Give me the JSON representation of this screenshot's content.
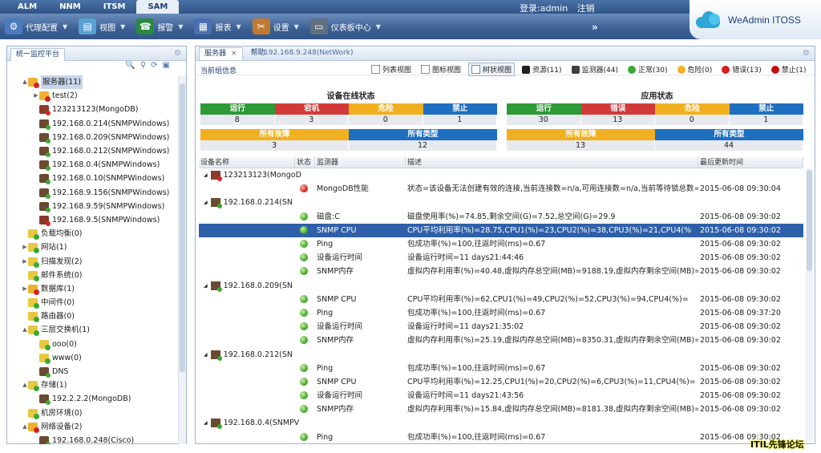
{
  "top_tabs": [
    "ALM",
    "NNM",
    "ITSM",
    "SAM"
  ],
  "login": {
    "label": "登录:admin",
    "logout": "注销"
  },
  "toolbar": [
    {
      "label": "代理配置",
      "icon": "agent-icon",
      "color": "#4a7ac0"
    },
    {
      "label": "视图",
      "icon": "view-icon",
      "color": "#5aa0d0"
    },
    {
      "label": "报警",
      "icon": "alarm-icon",
      "color": "#2a8a40"
    },
    {
      "label": "报表",
      "icon": "report-icon",
      "color": "#4a70b0"
    },
    {
      "label": "设置",
      "icon": "settings-icon",
      "color": "#c07a30"
    },
    {
      "label": "仪表板中心",
      "icon": "dashboard-icon",
      "color": "#607080"
    }
  ],
  "toolbar_more": "»",
  "brand": "WeAdmin ITOSS",
  "left_panel": {
    "title": "统一监控平台",
    "tree": [
      {
        "label": "服务器(11)",
        "icon": "folder-red",
        "depth": 0,
        "exp": "▲",
        "selected": true
      },
      {
        "label": "test(2)",
        "icon": "folder-red",
        "depth": 1,
        "exp": "▶"
      },
      {
        "label": "123213123(MongoDB)",
        "icon": "server-red",
        "depth": 1,
        "exp": ""
      },
      {
        "label": "192.168.0.214(SNMPWindows)",
        "icon": "server-ok",
        "depth": 1,
        "exp": ""
      },
      {
        "label": "192.168.0.209(SNMPWindows)",
        "icon": "server-ok",
        "depth": 1,
        "exp": ""
      },
      {
        "label": "192.168.0.212(SNMPWindows)",
        "icon": "server-ok",
        "depth": 1,
        "exp": ""
      },
      {
        "label": "192.168.0.4(SNMPWindows)",
        "icon": "server-ok",
        "depth": 1,
        "exp": ""
      },
      {
        "label": "192.168.0.10(SNMPWindows)",
        "icon": "server-ok",
        "depth": 1,
        "exp": ""
      },
      {
        "label": "192.168.9.156(SNMPWindows)",
        "icon": "server-ok",
        "depth": 1,
        "exp": ""
      },
      {
        "label": "192.168.9.59(SNMPWindows)",
        "icon": "server-ok",
        "depth": 1,
        "exp": ""
      },
      {
        "label": "192.168.9.5(SNMPWindows)",
        "icon": "server-red",
        "depth": 1,
        "exp": ""
      },
      {
        "label": "负载均衡(0)",
        "icon": "folder-ok",
        "depth": 0,
        "exp": ""
      },
      {
        "label": "网站(1)",
        "icon": "folder-ok",
        "depth": 0,
        "exp": "▶"
      },
      {
        "label": "扫描发现(2)",
        "icon": "folder-ok",
        "depth": 0,
        "exp": "▶"
      },
      {
        "label": "邮件系统(0)",
        "icon": "folder-ok",
        "depth": 0,
        "exp": ""
      },
      {
        "label": "数据库(1)",
        "icon": "folder-red",
        "depth": 0,
        "exp": "▶"
      },
      {
        "label": "中间件(0)",
        "icon": "folder-ok",
        "depth": 0,
        "exp": ""
      },
      {
        "label": "路由器(0)",
        "icon": "folder-ok",
        "depth": 0,
        "exp": ""
      },
      {
        "label": "三层交换机(1)",
        "icon": "folder-ok",
        "depth": 0,
        "exp": "▲"
      },
      {
        "label": "ooo(0)",
        "icon": "folder-ok",
        "depth": 1,
        "exp": ""
      },
      {
        "label": "www(0)",
        "icon": "folder-ok",
        "depth": 1,
        "exp": ""
      },
      {
        "label": "DNS",
        "icon": "server-ok",
        "depth": 1,
        "exp": ""
      },
      {
        "label": "存储(1)",
        "icon": "folder-ok",
        "depth": 0,
        "exp": "▲"
      },
      {
        "label": "192.2.2.2(MongoDB)",
        "icon": "server-ok",
        "depth": 1,
        "exp": ""
      },
      {
        "label": "机房环境(0)",
        "icon": "folder-ok",
        "depth": 0,
        "exp": ""
      },
      {
        "label": "网络设备(2)",
        "icon": "folder-red",
        "depth": 0,
        "exp": "▲"
      },
      {
        "label": "192.168.0.248(Cisco)",
        "icon": "server-ok",
        "depth": 1,
        "exp": ""
      }
    ]
  },
  "right_panel": {
    "tabs": [
      {
        "label": "服务器",
        "close": "×"
      },
      {
        "label": "帮助",
        "close": ""
      }
    ],
    "title": "192.168.9.248(NetWork)",
    "group_info": "当前组信息",
    "views": [
      "列表视图",
      "图标视图",
      "树状视图"
    ],
    "filters": [
      {
        "label": "资源(11)",
        "color": "#202020"
      },
      {
        "label": "监测器(44)",
        "color": "#404040"
      },
      {
        "label": "正常(30)",
        "color": "#3aa830"
      },
      {
        "label": "危险(0)",
        "color": "#f0b020"
      },
      {
        "label": "错误(13)",
        "color": "#d42020"
      },
      {
        "label": "禁止(1)",
        "color": "#c01010"
      }
    ],
    "device_status": {
      "title": "设备在线状态",
      "row1": [
        {
          "label": "运行",
          "value": "8",
          "color": "#2e9a36"
        },
        {
          "label": "宕机",
          "value": "3",
          "color": "#d23a3a"
        },
        {
          "label": "危险",
          "value": "0",
          "color": "#f0b020"
        },
        {
          "label": "禁止",
          "value": "1",
          "color": "#1f6fc0"
        }
      ],
      "row2": [
        {
          "label": "所有故障",
          "value": "3",
          "color": "#f0b020"
        },
        {
          "label": "所有类型",
          "value": "12",
          "color": "#1f6fc0"
        }
      ]
    },
    "app_status": {
      "title": "应用状态",
      "row1": [
        {
          "label": "运行",
          "value": "30",
          "color": "#2e9a36"
        },
        {
          "label": "错误",
          "value": "13",
          "color": "#d23a3a"
        },
        {
          "label": "危险",
          "value": "0",
          "color": "#f0b020"
        },
        {
          "label": "禁止",
          "value": "1",
          "color": "#1f6fc0"
        }
      ],
      "row2": [
        {
          "label": "所有故障",
          "value": "13",
          "color": "#f0b020"
        },
        {
          "label": "所有类型",
          "value": "44",
          "color": "#1f6fc0"
        }
      ]
    },
    "table": {
      "headers": [
        "设备名称",
        "状态",
        "监测器",
        "描述",
        "最后更新时间"
      ],
      "rows": [
        {
          "group": "123213123(MongoD",
          "icon": "server-red"
        },
        {
          "status": "r",
          "monitor": "MongoDB性能",
          "desc": "状态=该设备无法创建有效的连接,当前连接数=n/a,可用连接数=n/a,当前等待锁总数=",
          "time": "2015-06-08 09:30:04"
        },
        {
          "group": "192.168.0.214(SN",
          "icon": "server-ok"
        },
        {
          "status": "g",
          "monitor": "磁盘:C",
          "desc": "磁盘使用率(%)=74.85,剩余空间(G)=7.52,总空间(G)=29.9",
          "time": "2015-06-08 09:30:02"
        },
        {
          "status": "g",
          "monitor": "SNMP CPU",
          "desc": "CPU平均利用率(%)=28.75,CPU1(%)=23,CPU2(%)=38,CPU3(%)=21,CPU4(%",
          "time": "2015-06-08 09:30:02",
          "selected": true
        },
        {
          "status": "g",
          "monitor": "Ping",
          "desc": "包成功率(%)=100,往返时间(ms)=0.67",
          "time": "2015-06-08 09:30:02"
        },
        {
          "status": "g",
          "monitor": "设备运行时间",
          "desc": "设备运行时间=11 days21:44:46",
          "time": "2015-06-08 09:30:02"
        },
        {
          "status": "g",
          "monitor": "SNMP内存",
          "desc": "虚拟内存利用率(%)=40.48,虚拟内存总空间(MB)=9188.19,虚拟内存剩余空间(MB)=",
          "time": "2015-06-08 09:30:02"
        },
        {
          "group": "192.168.0.209(SN",
          "icon": "server-ok"
        },
        {
          "status": "g",
          "monitor": "SNMP CPU",
          "desc": "CPU平均利用率(%)=62,CPU1(%)=49,CPU2(%)=52,CPU3(%)=94,CPU4(%)=",
          "time": "2015-06-08 09:30:02"
        },
        {
          "status": "g",
          "monitor": "Ping",
          "desc": "包成功率(%)=100,往返时间(ms)=0.67",
          "time": "2015-06-08 09:37:20"
        },
        {
          "status": "g",
          "monitor": "设备运行时间",
          "desc": "设备运行时间=11 days21:35:02",
          "time": "2015-06-08 09:30:02"
        },
        {
          "status": "g",
          "monitor": "SNMP内存",
          "desc": "虚拟内存利用率(%)=25.19,虚拟内存总空间(MB)=8350.31,虚拟内存剩余空间(MB)=",
          "time": "2015-06-08 09:30:02"
        },
        {
          "group": "192.168.0.212(SN",
          "icon": "server-ok"
        },
        {
          "status": "g",
          "monitor": "Ping",
          "desc": "包成功率(%)=100,往返时间(ms)=0.67",
          "time": "2015-06-08 09:30:02"
        },
        {
          "status": "g",
          "monitor": "SNMP CPU",
          "desc": "CPU平均利用率(%)=12.25,CPU1(%)=20,CPU2(%)=6,CPU3(%)=11,CPU4(%)=",
          "time": "2015-06-08 09:30:02"
        },
        {
          "status": "g",
          "monitor": "设备运行时间",
          "desc": "设备运行时间=11 days21:43:56",
          "time": "2015-06-08 09:30:02"
        },
        {
          "status": "g",
          "monitor": "SNMP内存",
          "desc": "虚拟内存利用率(%)=15.84,虚拟内存总空间(MB)=8181.38,虚拟内存剩余空间(MB)=",
          "time": "2015-06-08 09:30:02"
        },
        {
          "group": "192.168.0.4(SNMPV",
          "icon": "server-ok"
        },
        {
          "status": "g",
          "monitor": "Ping",
          "desc": "包成功率(%)=100,往返时间(ms)=0.67",
          "time": "2015-06-08 09:30:02"
        }
      ]
    }
  },
  "watermark": "ITIL先锋论坛"
}
